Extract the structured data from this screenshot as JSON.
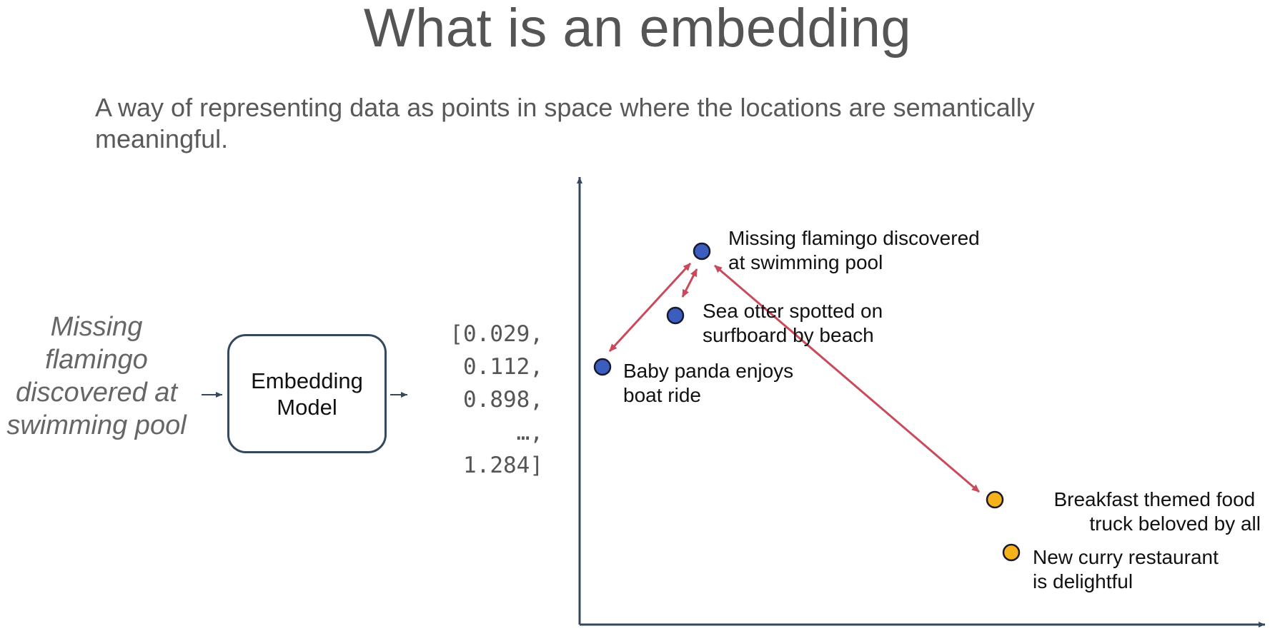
{
  "title": "What is an embedding",
  "subtitle": "A way of representing data as points in space where the locations are semantically meaningful.",
  "input_text": "Missing flamingo discovered at swimming pool",
  "model_label": [
    "Embedding",
    "Model"
  ],
  "vector": [
    "[0.029,",
    "0.112,",
    "0.898,",
    "…,",
    "1.284]"
  ],
  "colors": {
    "axis": "#34495e",
    "point_blue": "#3a5dbf",
    "point_orange": "#f6b21a",
    "arrow": "#c94a5a"
  },
  "points": [
    {
      "id": "flamingo",
      "label": [
        "Missing flamingo discovered",
        "at swimming pool"
      ],
      "color": "blue"
    },
    {
      "id": "otter",
      "label": [
        "Sea otter spotted on",
        "surfboard by beach"
      ],
      "color": "blue"
    },
    {
      "id": "panda",
      "label": [
        "Baby panda enjoys",
        "boat ride"
      ],
      "color": "blue"
    },
    {
      "id": "breakfast",
      "label": [
        "Breakfast themed food",
        "truck beloved by all"
      ],
      "color": "orange"
    },
    {
      "id": "curry",
      "label": [
        "New curry restaurant",
        "is delightful"
      ],
      "color": "orange"
    }
  ]
}
